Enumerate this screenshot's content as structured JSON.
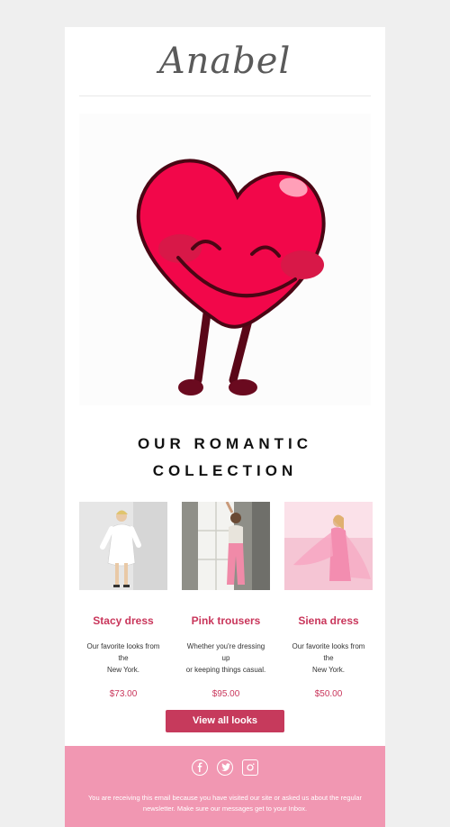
{
  "brand": {
    "logo_text": "Anabel"
  },
  "hero": {
    "image_alt": "smiling-heart"
  },
  "section": {
    "title_line1": "OUR ROMANTIC",
    "title_line2": "COLLECTION"
  },
  "products": [
    {
      "name": "Stacy dress",
      "desc_line1": "Our favorite looks from the",
      "desc_line2": "New York.",
      "price": "$73.00"
    },
    {
      "name": "Pink trousers",
      "desc_line1": "Whether you're dressing up",
      "desc_line2": "or keeping things casual.",
      "price": "$95.00"
    },
    {
      "name": "Siena dress",
      "desc_line1": "Our favorite looks from the",
      "desc_line2": "New York.",
      "price": "$50.00"
    }
  ],
  "cta": {
    "label": "View all looks"
  },
  "footer": {
    "social_icons": [
      "facebook-icon",
      "twitter-icon",
      "instagram-icon"
    ],
    "line1": "You are receiving this email because you have visited our site or asked us about the regular",
    "line2": "newsletter. Make sure our messages get to your Inbox."
  },
  "colors": {
    "accent": "#c63a5c",
    "footer_bg": "#f197b2",
    "page_bg": "#efefef"
  }
}
